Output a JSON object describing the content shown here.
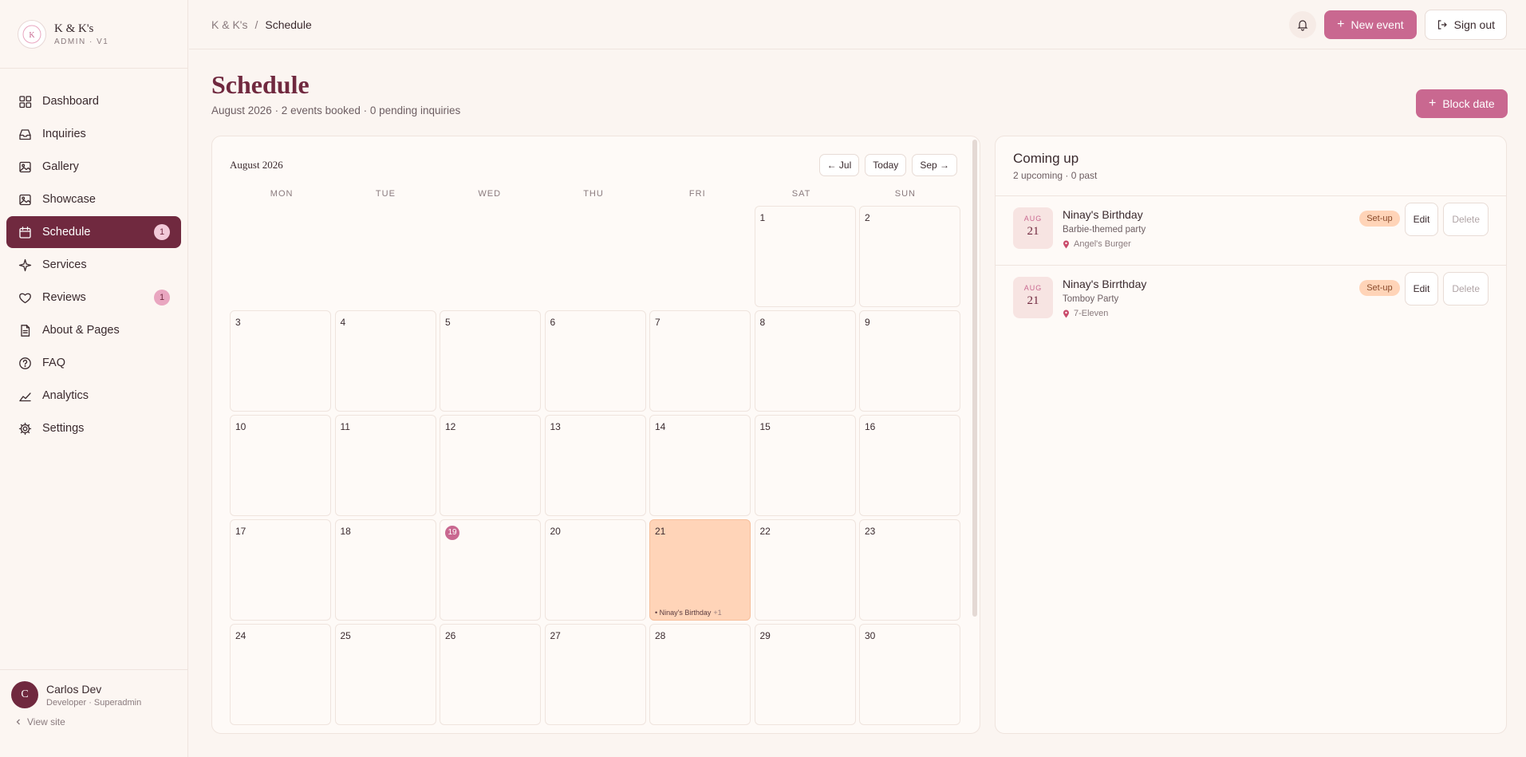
{
  "brand": {
    "name": "K & K's",
    "sub": "ADMIN · V1"
  },
  "sidebar": {
    "items": [
      {
        "label": "Dashboard",
        "icon": "dashboard-icon"
      },
      {
        "label": "Inquiries",
        "icon": "inbox-icon"
      },
      {
        "label": "Gallery",
        "icon": "image-icon"
      },
      {
        "label": "Showcase",
        "icon": "image-icon"
      },
      {
        "label": "Schedule",
        "icon": "calendar-icon",
        "badge": "1",
        "active": true
      },
      {
        "label": "Services",
        "icon": "sparkle-icon"
      },
      {
        "label": "Reviews",
        "icon": "heart-icon",
        "badge": "1"
      },
      {
        "label": "About & Pages",
        "icon": "document-icon"
      },
      {
        "label": "FAQ",
        "icon": "help-icon"
      },
      {
        "label": "Analytics",
        "icon": "chart-icon"
      },
      {
        "label": "Settings",
        "icon": "gear-icon"
      }
    ]
  },
  "user": {
    "initial": "C",
    "name": "Carlos Dev",
    "role": "Developer · Superadmin",
    "view_site": "View site"
  },
  "topbar": {
    "crumb_root": "K & K's",
    "crumb_sep": "/",
    "crumb_current": "Schedule",
    "new_event": "New event",
    "sign_out": "Sign out"
  },
  "page": {
    "title": "Schedule",
    "subtitle": "August 2026 · 2 events booked · 0 pending inquiries",
    "block_date": "Block date"
  },
  "calendar": {
    "month_label": "August 2026",
    "prev": "← Jul",
    "today": "Today",
    "next": "Sep →",
    "weekdays": [
      "MON",
      "TUE",
      "WED",
      "THU",
      "FRI",
      "SAT",
      "SUN"
    ],
    "leading_blanks": 5,
    "days_shown": 30,
    "today_day": 19,
    "event_day": 21,
    "event_label": "• Ninay's Birthday",
    "event_more": "+1"
  },
  "upcoming": {
    "title": "Coming up",
    "subtitle": "2 upcoming · 0 past",
    "events": [
      {
        "month": "AUG",
        "day": "21",
        "name": "Ninay's Birthday",
        "desc": "Barbie-themed party",
        "location": "Angel's Burger",
        "status": "Set-up",
        "edit": "Edit",
        "delete": "Delete"
      },
      {
        "month": "AUG",
        "day": "21",
        "name": "Ninay's Birrthday",
        "desc": "Tomboy Party",
        "location": "7-Eleven",
        "status": "Set-up",
        "edit": "Edit",
        "delete": "Delete"
      }
    ]
  },
  "colors": {
    "accent": "#70293f",
    "pink": "#c96890",
    "event": "#ffd4b8",
    "background": "#fbf5f1"
  }
}
